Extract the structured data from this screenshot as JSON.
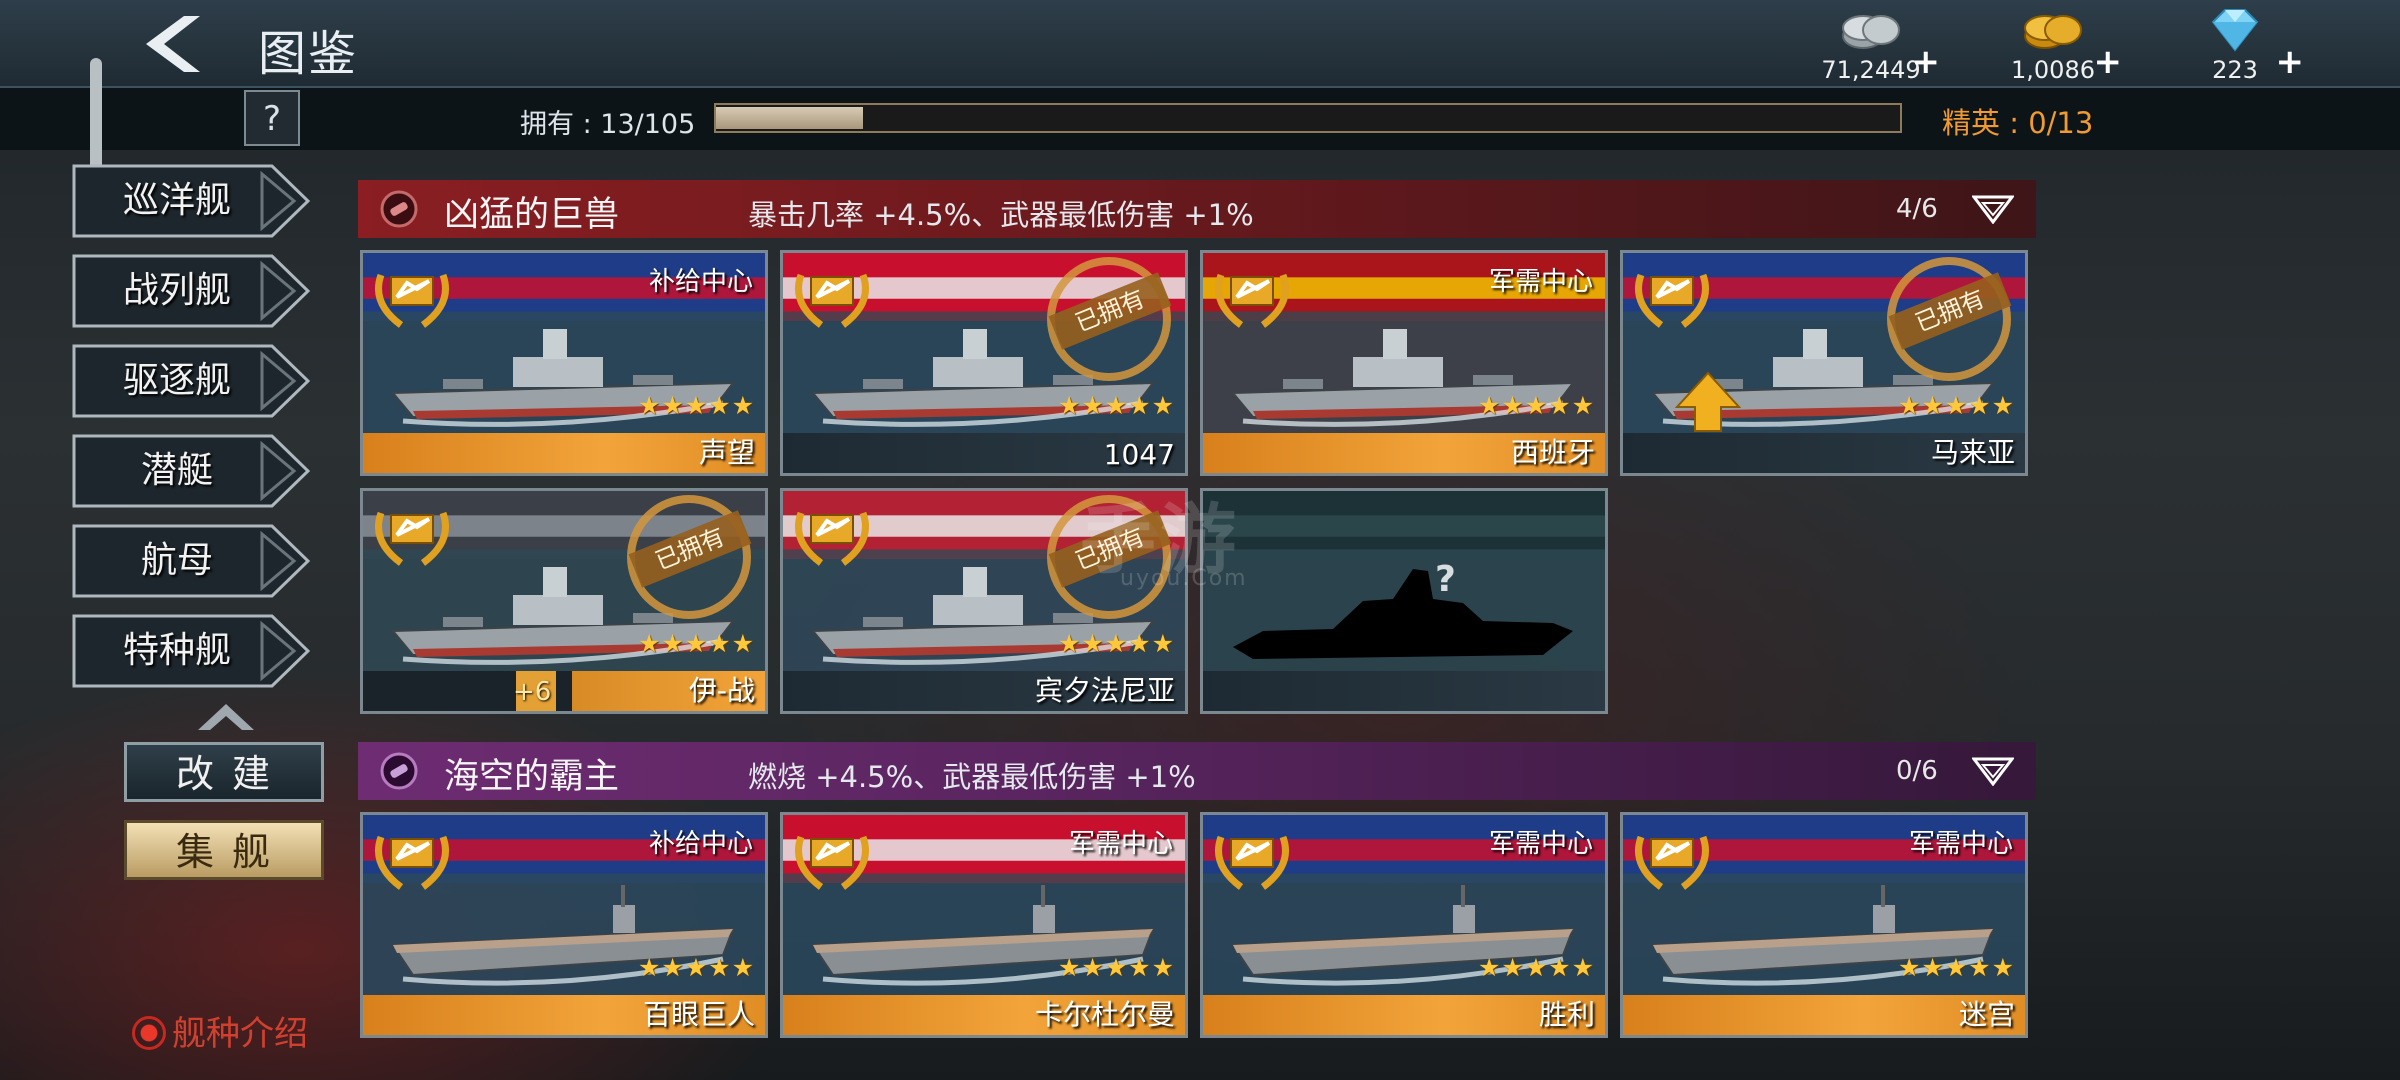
{
  "header": {
    "title": "图鉴",
    "currencies": [
      {
        "value": "71,2449",
        "icon": "silver-coin-icon"
      },
      {
        "value": "1,0086",
        "icon": "gold-coin-icon"
      },
      {
        "value": "223",
        "icon": "diamond-icon"
      }
    ],
    "plus": "+"
  },
  "progress": {
    "help_label": "?",
    "owned_text": "拥有 : 13/105",
    "owned": 13,
    "total": 105,
    "elite_text": "精英 : 0/13"
  },
  "side_tabs": [
    {
      "label": "巡洋舰"
    },
    {
      "label": "战列舰"
    },
    {
      "label": "驱逐舰"
    },
    {
      "label": "潜艇"
    },
    {
      "label": "航母"
    },
    {
      "label": "特种舰"
    }
  ],
  "buttons": {
    "modify": "改建",
    "collect": "集舰",
    "intro": "舰种介绍"
  },
  "groups": [
    {
      "name": "凶猛的巨兽",
      "bonus": "暴击几率 +4.5%、武器最低伤害 +1%",
      "count": "4/6",
      "color": "#8a1e22",
      "cards": [
        {
          "name": "声望",
          "source": "补给中心",
          "stars": "★★★★★",
          "owned": false,
          "bar": "orange"
        },
        {
          "name": "1047",
          "source": "",
          "stars": "★★★★★",
          "owned": true,
          "owned_label": "已拥有",
          "bar": "dark"
        },
        {
          "name": "西班牙",
          "source": "军需中心",
          "stars": "★★★★★",
          "owned": false,
          "bar": "orange"
        },
        {
          "name": "马来亚",
          "source": "",
          "stars": "★★★★★",
          "owned": true,
          "owned_label": "已拥有",
          "bar": "dark",
          "upgrade": true
        },
        {
          "name": "伊-战",
          "source": "",
          "stars": "★★★★★",
          "owned": true,
          "owned_label": "已拥有",
          "bar": "mixed",
          "level": "+6"
        },
        {
          "name": "宾夕法尼亚",
          "source": "",
          "stars": "★★★★★",
          "owned": true,
          "owned_label": "已拥有",
          "bar": "dark"
        },
        {
          "name": "",
          "source": "",
          "stars": "",
          "owned": false,
          "bar": "dark",
          "locked": true,
          "mark": "?"
        }
      ]
    },
    {
      "name": "海空的霸主",
      "bonus": "燃烧 +4.5%、武器最低伤害 +1%",
      "count": "0/6",
      "color": "#6e2c72",
      "cards": [
        {
          "name": "百眼巨人",
          "source": "补给中心",
          "stars": "★★★★★",
          "owned": false,
          "bar": "orange"
        },
        {
          "name": "卡尔杜尔曼",
          "source": "军需中心",
          "stars": "★★★★★",
          "owned": false,
          "bar": "orange"
        },
        {
          "name": "胜利",
          "source": "军需中心",
          "stars": "★★★★★",
          "owned": false,
          "bar": "orange"
        },
        {
          "name": "迷宫",
          "source": "军需中心",
          "stars": "★★★★★",
          "owned": false,
          "bar": "orange"
        }
      ]
    }
  ],
  "watermark": {
    "main": "手游",
    "sub": "uyou.Com"
  }
}
